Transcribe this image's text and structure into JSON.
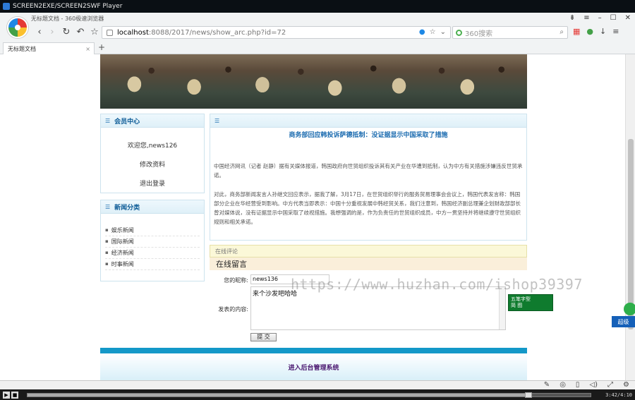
{
  "player": {
    "window_title": "SCREEN2EXE/SCREEN2SWF Player",
    "progress_fraction": 0.89,
    "time": "3:42/4:10"
  },
  "browser": {
    "title": "无标题文档 - 360极速浏览器",
    "tab_title": "无标题文档",
    "url_host": "localhost",
    "url_path": ":8088/2017/news/show_arc.php?id=72",
    "search_placeholder": "360搜索",
    "tab_close": "×",
    "new_tab": "+"
  },
  "member": {
    "header": "会员中心",
    "welcome": "欢迎您,news126",
    "modify": "修改资料",
    "logout": "退出登录"
  },
  "categories": {
    "header": "新闻分类",
    "items": [
      "娱乐新闻",
      "国际新闻",
      "经济新闻",
      "时事新闻"
    ]
  },
  "article": {
    "title": "商务部回应韩投诉萨德抵制：没证据显示中国采取了措施",
    "paragraph1": "中国经济网讯（记者 赵静）据有关媒体报道，韩国政府向世贸组织投诉其有关产业在华遭到抵制，认为中方有关措施涉嫌违反世贸承诺。",
    "paragraph2": "对此，商务部新闻发言人孙继文回应表示，据我了解，3月17日，在世贸组织举行的服务贸易理事会会议上，韩国代表发言称：韩国部分企业在华经营受到影响。中方代表当即表示：中国十分重视发展中韩经贸关系，我们注意到，韩国经济副总理兼企划财政部部长曾对媒体说，没有证据显示中国采取了歧视措施。我想强调的是，作为负责任的世贸组织成员，中方一贯坚持并将继续遵守世贸组织规则和相关承诺。"
  },
  "comment": {
    "section_label": "在线评论",
    "box_title": "在线留言",
    "name_label": "您的昵称:",
    "name_value": "news136",
    "content_label": "发表的内容:",
    "content_value": "来个沙发吧哈哈",
    "submit": "提 交"
  },
  "watermark": "https://www.huzhan.com/ishop39397",
  "footer": {
    "admin_link": "进入后台管理系统"
  },
  "ime": {
    "line1": "五笔字型",
    "line2": "简 图"
  },
  "corner_badge": "超级",
  "colors": {
    "accent_blue": "#1c6cb0",
    "footer_text": "#4b1870",
    "footer_bar": "#1398c8"
  }
}
